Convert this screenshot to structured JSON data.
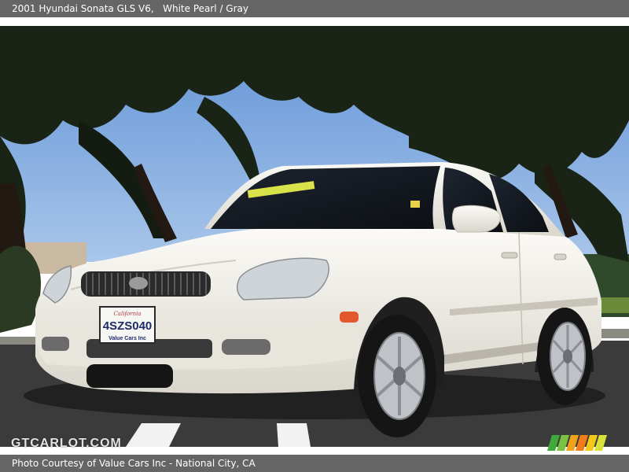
{
  "header": {
    "title": "2001 Hyundai Sonata GLS V6,   White Pearl / Gray"
  },
  "photo": {
    "plate_text": "4SZS040",
    "plate_frame_text": "Value Cars Inc",
    "plate_state_text": "California"
  },
  "watermark": {
    "text": "GTCARLOT.COM"
  },
  "footer": {
    "credit": "Photo Courtesy of Value Cars Inc - National City, CA"
  },
  "colors": {
    "bar": "#656565",
    "sky": "#6f9fd8",
    "car": "#f2f0ea",
    "asphalt": "#3b3b3b"
  },
  "icons": {
    "logo": "stripes-logo-icon"
  }
}
